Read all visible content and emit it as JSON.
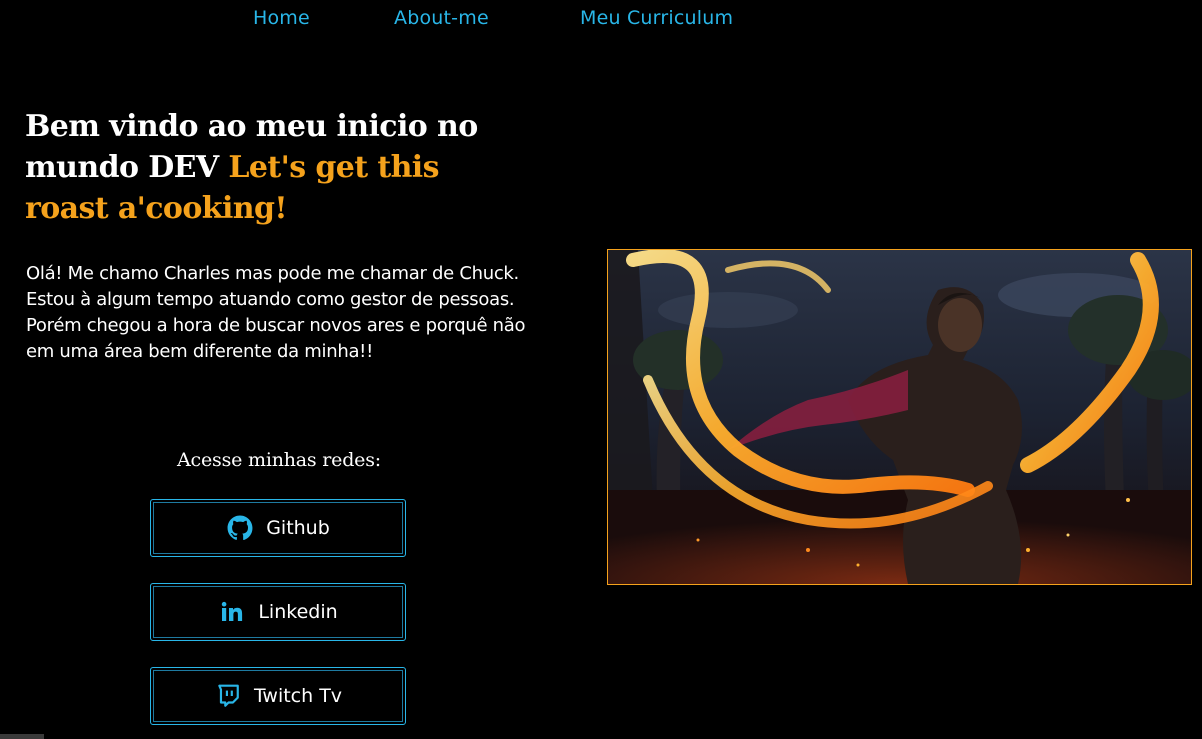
{
  "nav": {
    "home": "Home",
    "about": "About-me",
    "curriculum": "Meu Curriculum"
  },
  "headline": {
    "main": "Bem vindo ao meu inicio no mundo DEV ",
    "accent": "Let's get this roast a'cooking!"
  },
  "intro": {
    "text": "Olá! Me chamo Charles mas pode me chamar de Chuck. Estou à algum tempo atuando como gestor de pessoas. Porém chegou a hora de buscar novos ares e porquê não em uma área bem diferente da minha!!"
  },
  "social": {
    "title": "Acesse minhas redes:",
    "buttons": [
      {
        "label": "Github",
        "icon": "github-icon"
      },
      {
        "label": "Linkedin",
        "icon": "linkedin-icon"
      },
      {
        "label": "Twitch Tv",
        "icon": "twitch-icon"
      }
    ]
  },
  "hero": {
    "description_icon": "anime-warrior-illustration"
  },
  "colors": {
    "background": "#000000",
    "nav_link": "#29b6e8",
    "accent": "#f5a21c",
    "text": "#ffffff",
    "button_border": "#29b6e8"
  }
}
